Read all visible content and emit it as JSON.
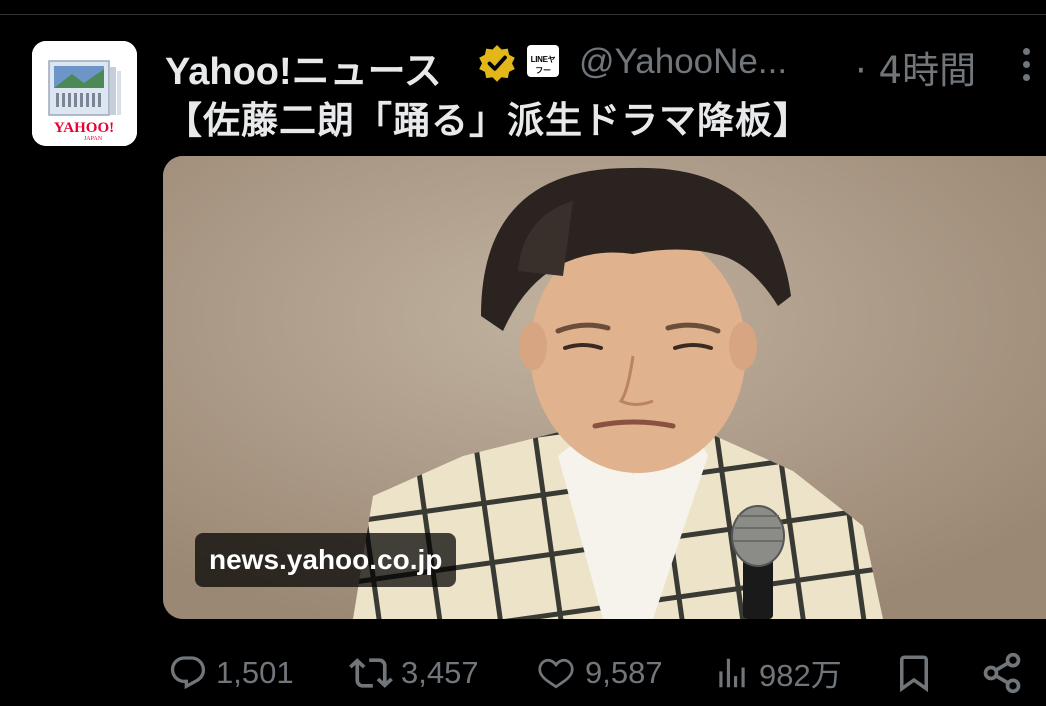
{
  "post": {
    "author": {
      "display_name": "Yahoo!ニュース",
      "handle": "@YahooNe...",
      "affiliate_badge_text": "LINEヤフー",
      "avatar_logo_text": "YAHOO!",
      "avatar_logo_subtext": "JAPAN"
    },
    "time": "· 4時間",
    "text": "【佐藤二朗「踊る」派生ドラマ降板】",
    "media": {
      "link_domain": "news.yahoo.co.jp"
    },
    "actions": {
      "replies": "1,501",
      "reposts": "3,457",
      "likes": "9,587",
      "views": "982万"
    }
  },
  "colors": {
    "background": "#000000",
    "text_primary": "#e7e9ea",
    "text_secondary": "#71767b",
    "verified_gold": "#e2b719",
    "logo_red": "#e60033"
  },
  "icons": {
    "verified": "gold-verified-badge-icon",
    "more": "more-vertical-icon",
    "reply": "reply-icon",
    "repost": "repost-icon",
    "like": "heart-icon",
    "views": "views-icon",
    "bookmark": "bookmark-icon",
    "share": "share-icon"
  }
}
